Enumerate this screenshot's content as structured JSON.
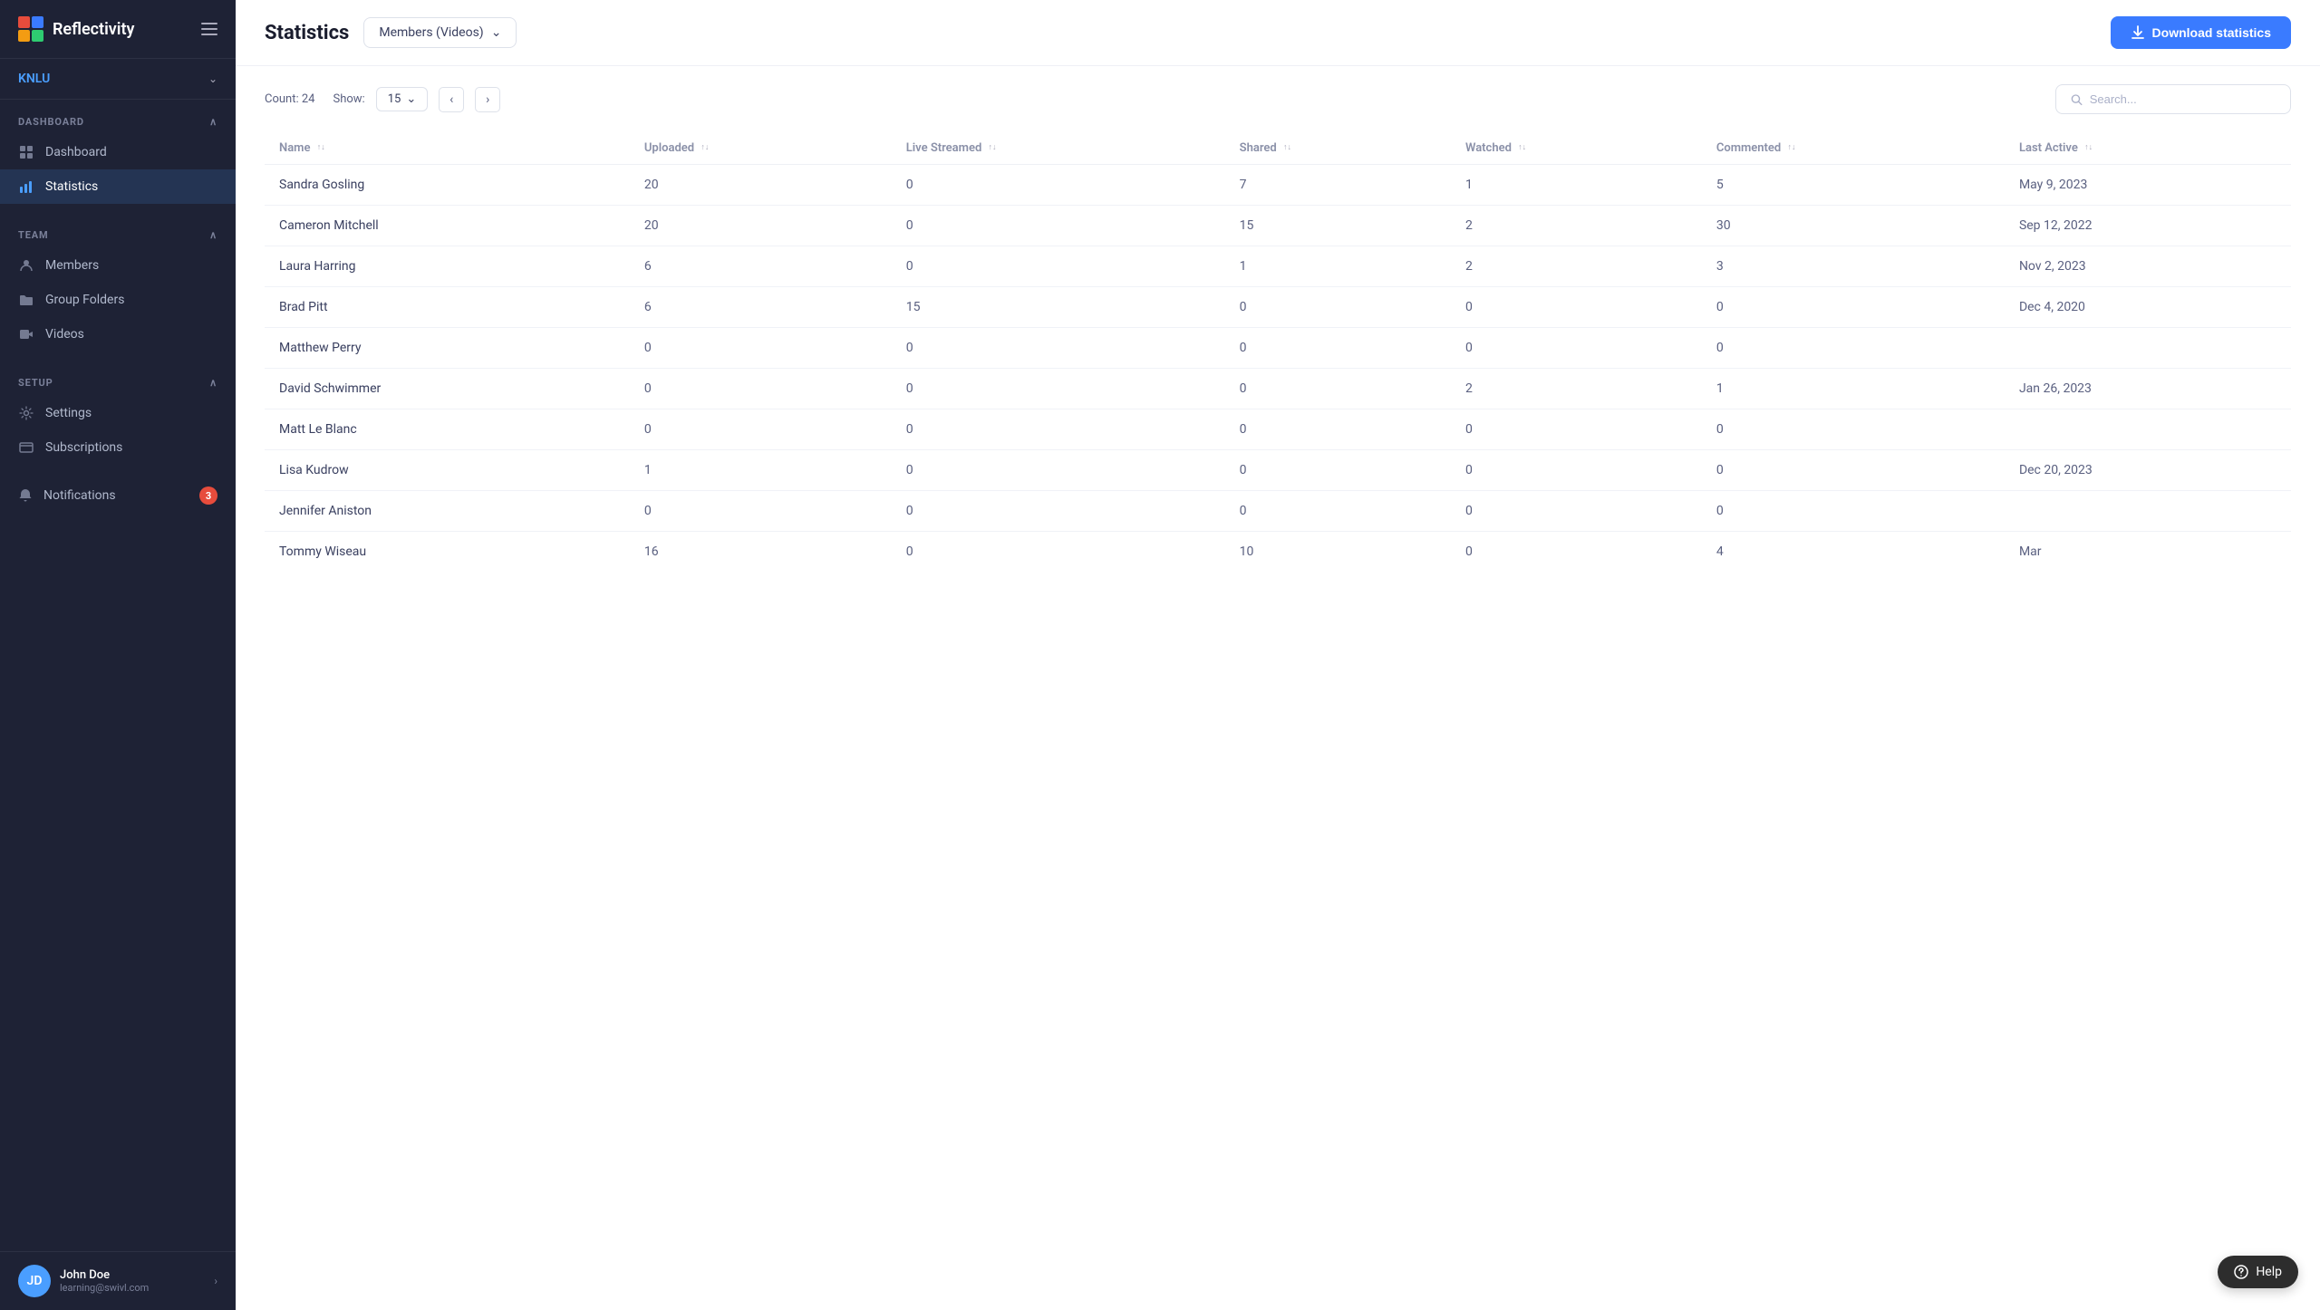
{
  "app": {
    "name": "Reflectivity"
  },
  "sidebar": {
    "org": "KNLU",
    "sections": {
      "dashboard": {
        "label": "DASHBOARD",
        "items": [
          {
            "id": "dashboard",
            "label": "Dashboard",
            "icon": "dashboard"
          }
        ]
      },
      "team": {
        "label": "TEAM",
        "items": [
          {
            "id": "members",
            "label": "Members",
            "icon": "members"
          },
          {
            "id": "group-folders",
            "label": "Group Folders",
            "icon": "folder"
          },
          {
            "id": "videos",
            "label": "Videos",
            "icon": "videos"
          }
        ]
      },
      "setup": {
        "label": "SETUP",
        "items": [
          {
            "id": "settings",
            "label": "Settings",
            "icon": "settings"
          },
          {
            "id": "subscriptions",
            "label": "Subscriptions",
            "icon": "subscriptions"
          }
        ]
      }
    },
    "active_item": "Statistics",
    "notifications": {
      "label": "Notifications",
      "badge": "3"
    },
    "user": {
      "name": "John Doe",
      "email": "learning@swivl.com"
    }
  },
  "header": {
    "title": "Statistics",
    "filter": "Members (Videos)",
    "download_btn": "Download statistics"
  },
  "table_controls": {
    "count_label": "Count:",
    "count": "24",
    "show_label": "Show:",
    "show_value": "15",
    "search_placeholder": "Search..."
  },
  "table": {
    "columns": [
      {
        "id": "name",
        "label": "Name"
      },
      {
        "id": "uploaded",
        "label": "Uploaded"
      },
      {
        "id": "live_streamed",
        "label": "Live Streamed"
      },
      {
        "id": "shared",
        "label": "Shared"
      },
      {
        "id": "watched",
        "label": "Watched"
      },
      {
        "id": "commented",
        "label": "Commented"
      },
      {
        "id": "last_active",
        "label": "Last Active"
      }
    ],
    "rows": [
      {
        "name": "Sandra Gosling",
        "uploaded": "20",
        "live_streamed": "0",
        "shared": "7",
        "watched": "1",
        "commented": "5",
        "last_active": "May 9, 2023"
      },
      {
        "name": "Cameron Mitchell",
        "uploaded": "20",
        "live_streamed": "0",
        "shared": "15",
        "watched": "2",
        "commented": "30",
        "last_active": "Sep 12, 2022"
      },
      {
        "name": "Laura Harring",
        "uploaded": "6",
        "live_streamed": "0",
        "shared": "1",
        "watched": "2",
        "commented": "3",
        "last_active": "Nov 2, 2023"
      },
      {
        "name": "Brad Pitt",
        "uploaded": "6",
        "live_streamed": "15",
        "shared": "0",
        "watched": "0",
        "commented": "0",
        "last_active": "Dec 4, 2020"
      },
      {
        "name": "Matthew Perry",
        "uploaded": "0",
        "live_streamed": "0",
        "shared": "0",
        "watched": "0",
        "commented": "0",
        "last_active": ""
      },
      {
        "name": "David Schwimmer",
        "uploaded": "0",
        "live_streamed": "0",
        "shared": "0",
        "watched": "2",
        "commented": "1",
        "last_active": "Jan 26, 2023"
      },
      {
        "name": "Matt Le Blanc",
        "uploaded": "0",
        "live_streamed": "0",
        "shared": "0",
        "watched": "0",
        "commented": "0",
        "last_active": ""
      },
      {
        "name": "Lisa Kudrow",
        "uploaded": "1",
        "live_streamed": "0",
        "shared": "0",
        "watched": "0",
        "commented": "0",
        "last_active": "Dec 20, 2023"
      },
      {
        "name": "Jennifer Aniston",
        "uploaded": "0",
        "live_streamed": "0",
        "shared": "0",
        "watched": "0",
        "commented": "0",
        "last_active": ""
      },
      {
        "name": "Tommy Wiseau",
        "uploaded": "16",
        "live_streamed": "0",
        "shared": "10",
        "watched": "0",
        "commented": "4",
        "last_active": "Mar"
      }
    ]
  },
  "help": {
    "label": "Help"
  }
}
